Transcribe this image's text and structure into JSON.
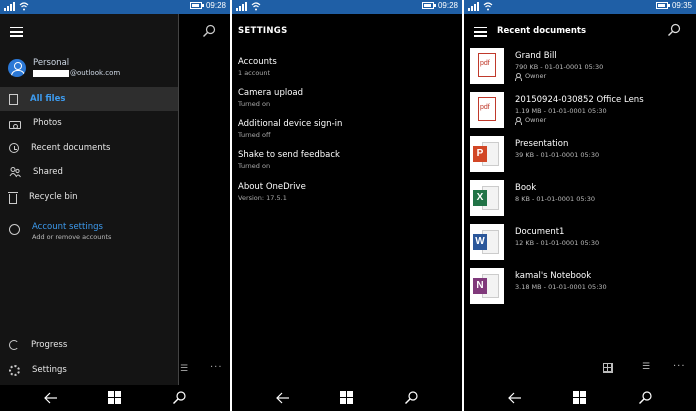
{
  "status": [
    {
      "time": "09:28"
    },
    {
      "time": "09:28"
    },
    {
      "time": "09:35"
    }
  ],
  "colors": {
    "statusbar": "#1f5fa6",
    "accent": "#3d9bef",
    "background": "#000000",
    "pane": "#141414"
  },
  "drawer": {
    "account_name": "Personal",
    "account_email": "@outlook.com",
    "items": [
      {
        "label": "All files",
        "icon": "file-icon"
      },
      {
        "label": "Photos",
        "icon": "camera-icon"
      },
      {
        "label": "Recent documents",
        "icon": "clock-icon"
      },
      {
        "label": "Shared",
        "icon": "shared-people-icon"
      },
      {
        "label": "Recycle bin",
        "icon": "recycle-bin-icon"
      }
    ],
    "account_settings": {
      "label": "Account settings",
      "sub": "Add or remove accounts"
    },
    "progress_label": "Progress",
    "settings_label": "Settings",
    "more_dots": "···"
  },
  "settings": {
    "title": "SETTINGS",
    "items": [
      {
        "label": "Accounts",
        "sub": "1 account"
      },
      {
        "label": "Camera upload",
        "sub": "Turned on"
      },
      {
        "label": "Additional device sign-in",
        "sub": "Turned off"
      },
      {
        "label": "Shake to send feedback",
        "sub": "Turned on"
      },
      {
        "label": "About OneDrive",
        "sub": "Version: 17.5.1"
      }
    ]
  },
  "recent": {
    "title": "Recent documents",
    "more_dots": "···",
    "docs": [
      {
        "name": "Grand Bill",
        "meta": "790 KB - 01-01-0001 05:30",
        "owner": "Owner",
        "type": "pdf",
        "thumb_text": "pdf"
      },
      {
        "name": "20150924-030852 Office Lens",
        "meta": "1.19 MB - 01-01-0001 05:30",
        "owner": "Owner",
        "type": "pdf",
        "thumb_text": "pdf"
      },
      {
        "name": "Presentation",
        "meta": "39 KB - 01-01-0001 05:30",
        "type": "powerpoint",
        "thumb_text": "P",
        "color": "#d24726"
      },
      {
        "name": "Book",
        "meta": "8 KB - 01-01-0001 05:30",
        "type": "excel",
        "thumb_text": "X",
        "color": "#217346"
      },
      {
        "name": "Document1",
        "meta": "12 KB - 01-01-0001 05:30",
        "type": "word",
        "thumb_text": "W",
        "color": "#2b579a"
      },
      {
        "name": "kamal's Notebook",
        "meta": "3.18 MB - 01-01-0001 05:30",
        "type": "onenote",
        "thumb_text": "N",
        "color": "#80397b"
      }
    ]
  }
}
